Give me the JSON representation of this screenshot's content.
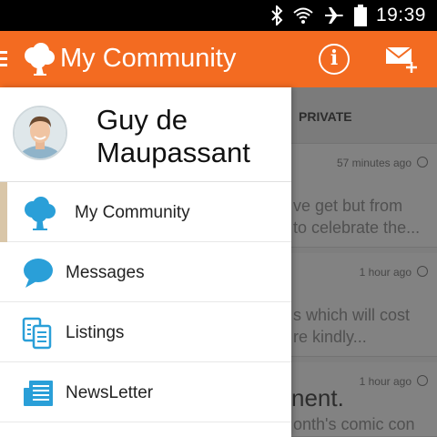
{
  "status_bar": {
    "time": "19:39",
    "icons": [
      "bluetooth-icon",
      "wifi-icon",
      "airplane-icon",
      "battery-icon"
    ]
  },
  "app_bar": {
    "title": "My Community",
    "icons": [
      "menu-icon",
      "tree-logo-icon",
      "info-icon",
      "compose-message-icon"
    ]
  },
  "drawer": {
    "user_name_line1": "Guy de",
    "user_name_line2": "Maupassant",
    "items": [
      {
        "label": "My Community",
        "icon": "tree-icon",
        "active": true
      },
      {
        "label": "Messages",
        "icon": "chat-bubble-icon",
        "active": false
      },
      {
        "label": "Listings",
        "icon": "documents-icon",
        "active": false
      },
      {
        "label": "NewsLetter",
        "icon": "newspaper-icon",
        "active": false
      }
    ]
  },
  "background": {
    "tab_private": "PRIVATE",
    "cards": [
      {
        "time": "57 minutes ago",
        "line1": "ve get but from",
        "line2": "to celebrate the..."
      },
      {
        "time": "1 hour ago",
        "line1": "s which will cost",
        "line2": "re kindly..."
      },
      {
        "time": "1 hour ago",
        "headline": "nent.",
        "line1": "onth's comic con"
      }
    ]
  },
  "colors": {
    "accent": "#f36b21",
    "icon_blue": "#2a9fd8",
    "active_indicator": "#d9c6a8"
  }
}
